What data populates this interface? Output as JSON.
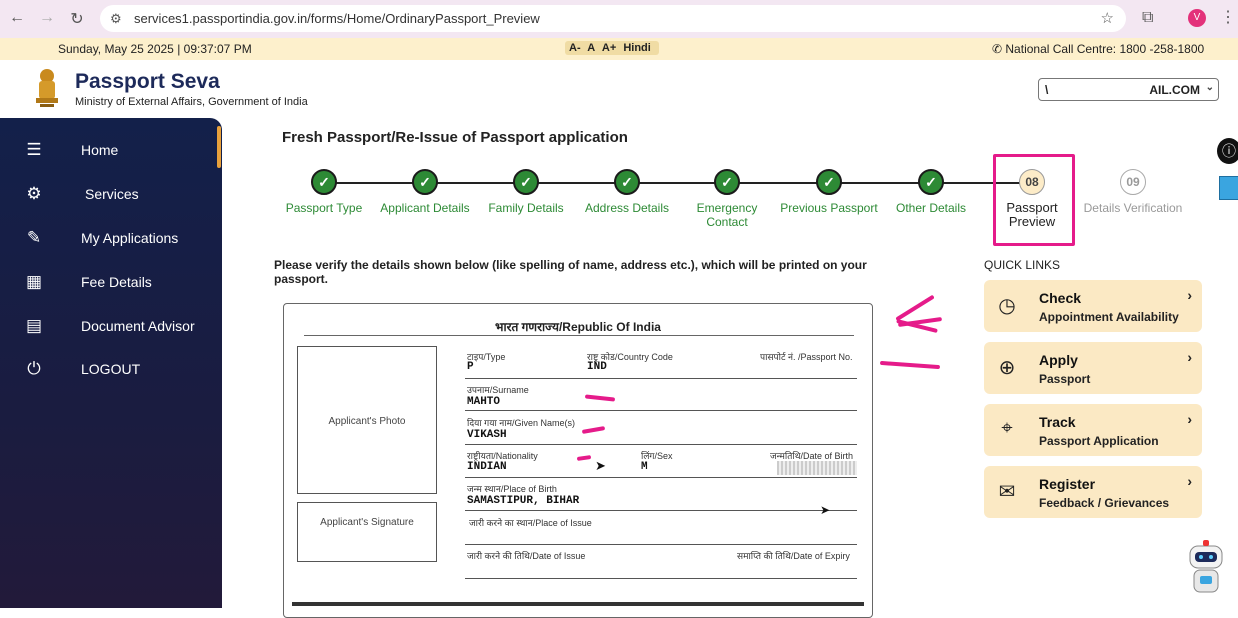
{
  "browser": {
    "url": "services1.passportindia.gov.in/forms/Home/OrdinaryPassport_Preview",
    "profile_initial": "V"
  },
  "infobar": {
    "datetime": "Sunday, May 25 2025 | 09:37:07 PM",
    "font_sizes": [
      "A-",
      "A",
      "A+"
    ],
    "language": "Hindi",
    "call_centre": "National Call Centre: 1800 -258-1800"
  },
  "header": {
    "brand": "Passport Seva",
    "ministry": "Ministry of External Affairs, Government of India",
    "user_left": "\\",
    "user_right": "AIL.COM"
  },
  "sidebar": {
    "items": [
      {
        "label": "Home",
        "icon": "menu-search-icon"
      },
      {
        "label": "Services",
        "icon": "hand-gear-icon"
      },
      {
        "label": "My Applications",
        "icon": "document-edit-icon"
      },
      {
        "label": "Fee Details",
        "icon": "calculator-icon"
      },
      {
        "label": "Document Advisor",
        "icon": "document-icon"
      },
      {
        "label": "LOGOUT",
        "icon": "logout-icon"
      }
    ]
  },
  "form": {
    "title": "Fresh Passport/Re-Issue of Passport application",
    "steps": [
      {
        "label": "Passport Type",
        "state": "done"
      },
      {
        "label": "Applicant Details",
        "state": "done"
      },
      {
        "label": "Family Details",
        "state": "done"
      },
      {
        "label": "Address Details",
        "state": "done"
      },
      {
        "label": "Emergency Contact",
        "state": "done"
      },
      {
        "label": "Previous Passport",
        "state": "done"
      },
      {
        "label": "Other Details",
        "state": "done"
      },
      {
        "label": "Passport Preview",
        "number": "08",
        "state": "current"
      },
      {
        "label": "Details Verification",
        "number": "09",
        "state": "future"
      }
    ],
    "verify_note": "Please verify the details shown below (like spelling of name, address etc.), which will be printed on your passport."
  },
  "passport": {
    "republic": "भारत गणराज्य/Republic Of India",
    "photo_label": "Applicant's Photo",
    "signature_label": "Applicant's Signature",
    "type_label": "टाइप/Type",
    "type_value": "P",
    "country_label": "राष्ट्र कोड/Country Code",
    "country_value": "IND",
    "passport_no_label": "पासपोर्ट नं. /Passport No.",
    "surname_label": "उपनाम/Surname",
    "surname_value": "MAHTO",
    "given_label": "दिया गया नाम/Given Name(s)",
    "given_value": "VIKASH",
    "nationality_label": "राष्ट्रीयता/Nationality",
    "nationality_value": "INDIAN",
    "sex_label": "लिंग/Sex",
    "sex_value": "M",
    "dob_label": "जन्मतिथि/Date of Birth",
    "pob_label": "जन्म स्थान/Place of Birth",
    "pob_value": "SAMASTIPUR, BIHAR",
    "poi_label": "जारी करने का स्थान/Place of Issue",
    "doi_label": "जारी करने की तिथि/Date of Issue",
    "doe_label": "समाप्ति की तिथि/Date of Expiry"
  },
  "quick_links": {
    "title": "QUICK LINKS",
    "items": [
      {
        "title": "Check",
        "subtitle": "Appointment Availability",
        "icon": "calendar-clock-icon"
      },
      {
        "title": "Apply",
        "subtitle": "Passport",
        "icon": "globe-passport-icon"
      },
      {
        "title": "Track",
        "subtitle": "Passport Application",
        "icon": "track-icon"
      },
      {
        "title": "Register",
        "subtitle": "Feedback / Grievances",
        "icon": "feedback-icon"
      }
    ]
  },
  "colors": {
    "step_done": "#2d8a35",
    "sidebar_bg": "#13204a",
    "quick_link_bg": "#fbe9c4",
    "annotation": "#e51b8a"
  }
}
